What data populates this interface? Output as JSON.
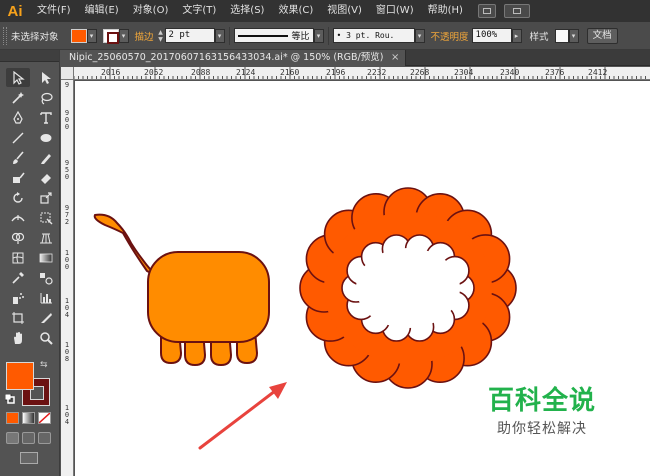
{
  "app": {
    "logo": "Ai"
  },
  "menubar": {
    "items": [
      "文件(F)",
      "编辑(E)",
      "对象(O)",
      "文字(T)",
      "选择(S)",
      "效果(C)",
      "视图(V)",
      "窗口(W)",
      "帮助(H)"
    ]
  },
  "controlbar": {
    "selection_label": "未选择对象",
    "stroke_label": "描边",
    "stroke_weight": "2 pt",
    "stroke_profile": "等比",
    "brush": "3 pt. Rou.",
    "opacity_label": "不透明度",
    "opacity_value": "100%",
    "style_label": "样式",
    "doc_button": "文档"
  },
  "document": {
    "tab_title": "Nipic_25060570_20170607163156433034.ai* @ 150% (RGB/预览)",
    "close_glyph": "×"
  },
  "ruler": {
    "horizontal": [
      "2016",
      "2052",
      "2088",
      "2124",
      "2160",
      "2196",
      "2232",
      "2268",
      "2304",
      "2340",
      "2376",
      "2412"
    ],
    "vertical": [
      "9",
      "900",
      "950",
      "972",
      "100",
      "104",
      "108",
      "104"
    ]
  },
  "colors": {
    "fill": "#ff5a00",
    "stroke": "#6b1111",
    "animal_body": "#ff8c00",
    "ring": "#ff5a00",
    "arrow": "#e8433d",
    "watermark": "#22b24c"
  },
  "watermark": {
    "title": "百科全说",
    "subtitle": "助你轻松解决"
  }
}
